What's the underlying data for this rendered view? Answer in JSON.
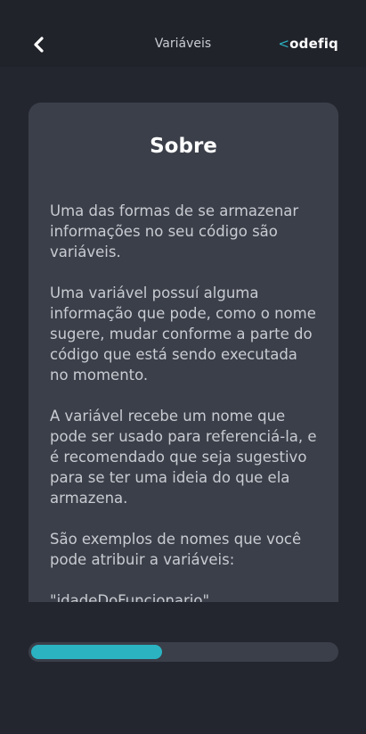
{
  "header": {
    "title": "Variáveis",
    "brand_bracket": "<",
    "brand_text": "odefiq"
  },
  "card": {
    "title": "Sobre",
    "paragraphs": [
      "Uma das formas de se armazenar informações no seu código são variáveis.",
      "Uma variável possuí alguma informação que pode, como o nome sugere, mudar conforme a parte do código que está sendo executada no momento.",
      "A variável recebe um nome que pode ser usado para referenciá-la, e é recomendado que seja sugestivo para se ter uma ideia do que ela armazena.",
      "São exemplos de nomes que você pode atribuir a variáveis:",
      "\"idadeDoFuncionario\""
    ]
  },
  "progress": {
    "fraction": 0.43
  },
  "icons": {
    "back": "chevron-left-icon"
  },
  "colors": {
    "background": "#24262f",
    "header": "#21232b",
    "card": "#3b3f49",
    "accent": "#2bb3c2",
    "text": "#c8cbd1"
  }
}
